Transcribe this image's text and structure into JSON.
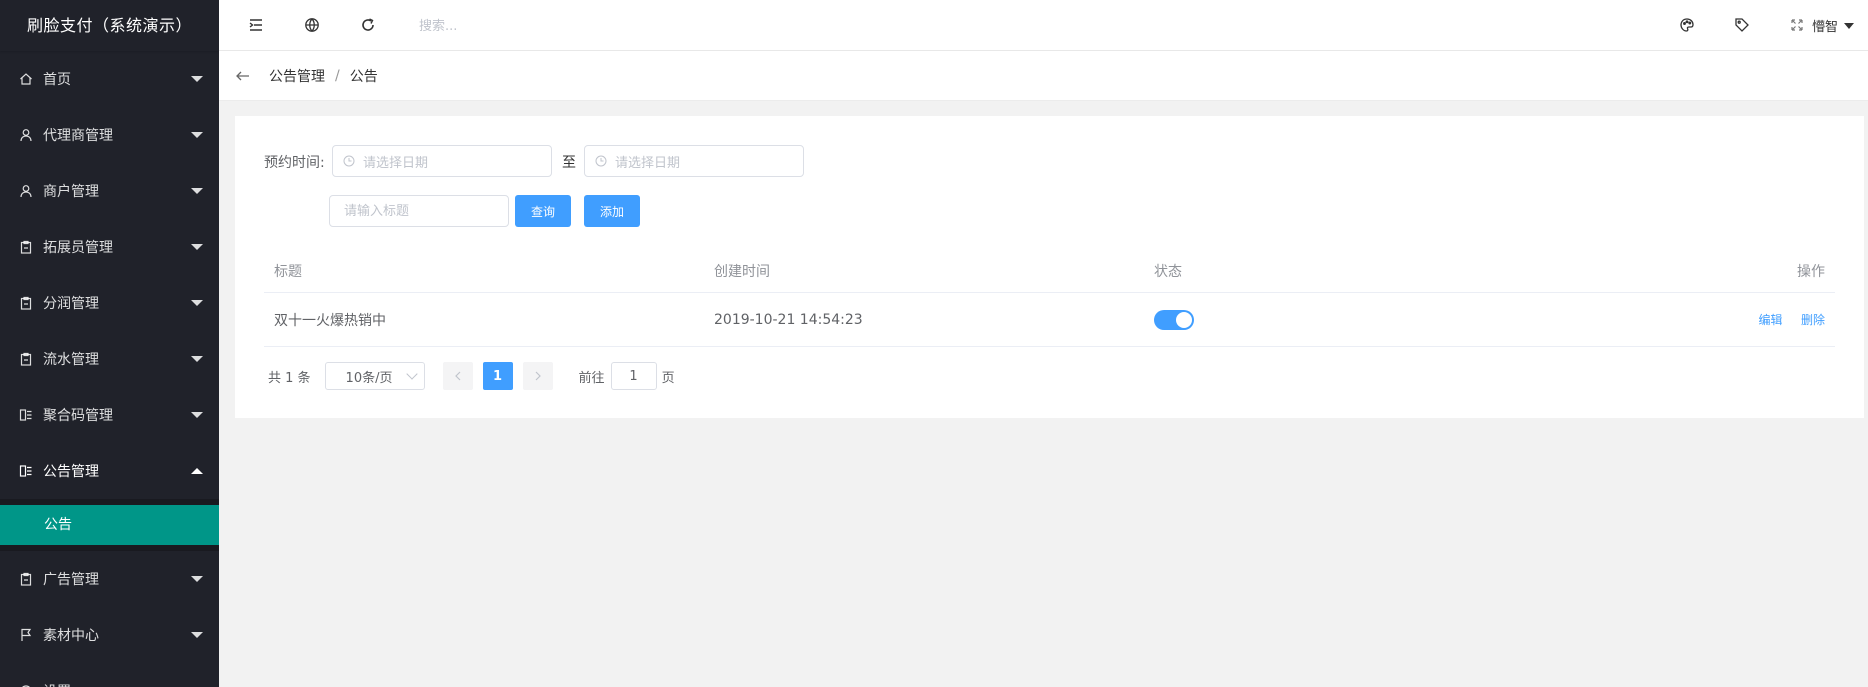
{
  "app": {
    "title": "刷脸支付（系统演示）"
  },
  "sidebar": {
    "items": [
      {
        "label": "首页",
        "icon": "home-icon"
      },
      {
        "label": "代理商管理",
        "icon": "user-icon"
      },
      {
        "label": "商户管理",
        "icon": "user-icon"
      },
      {
        "label": "拓展员管理",
        "icon": "clipboard-icon"
      },
      {
        "label": "分润管理",
        "icon": "clipboard-icon"
      },
      {
        "label": "流水管理",
        "icon": "clipboard-icon"
      },
      {
        "label": "聚合码管理",
        "icon": "list-icon"
      },
      {
        "label": "公告管理",
        "icon": "list-icon",
        "open": true
      },
      {
        "label": "广告管理",
        "icon": "clipboard-icon"
      },
      {
        "label": "素材中心",
        "icon": "flag-icon"
      },
      {
        "label": "设置",
        "icon": "gear-icon"
      }
    ],
    "active_sub": "公告"
  },
  "header": {
    "search_placeholder": "搜索...",
    "username": "懵智"
  },
  "breadcrumb": {
    "parent": "公告管理",
    "separator": "/",
    "current": "公告"
  },
  "filters": {
    "date_label": "预约时间:",
    "date_start_placeholder": "请选择日期",
    "date_to": "至",
    "date_end_placeholder": "请选择日期",
    "title_placeholder": "请输入标题",
    "query_label": "查询",
    "add_label": "添加"
  },
  "table": {
    "columns": [
      "标题",
      "创建时间",
      "状态",
      "操作"
    ],
    "rows": [
      {
        "title": "双十一火爆热销中",
        "created": "2019-10-21 14:54:23",
        "status_on": true,
        "edit": "编辑",
        "delete": "删除"
      }
    ]
  },
  "pagination": {
    "total": "共 1 条",
    "page_size": "10条/页",
    "current_page": "1",
    "goto_label": "前往",
    "goto_value": "1",
    "page_suffix": "页"
  },
  "colors": {
    "sidebar_bg": "#20222a",
    "active_sub_bg": "#009688",
    "primary": "#409eff"
  }
}
